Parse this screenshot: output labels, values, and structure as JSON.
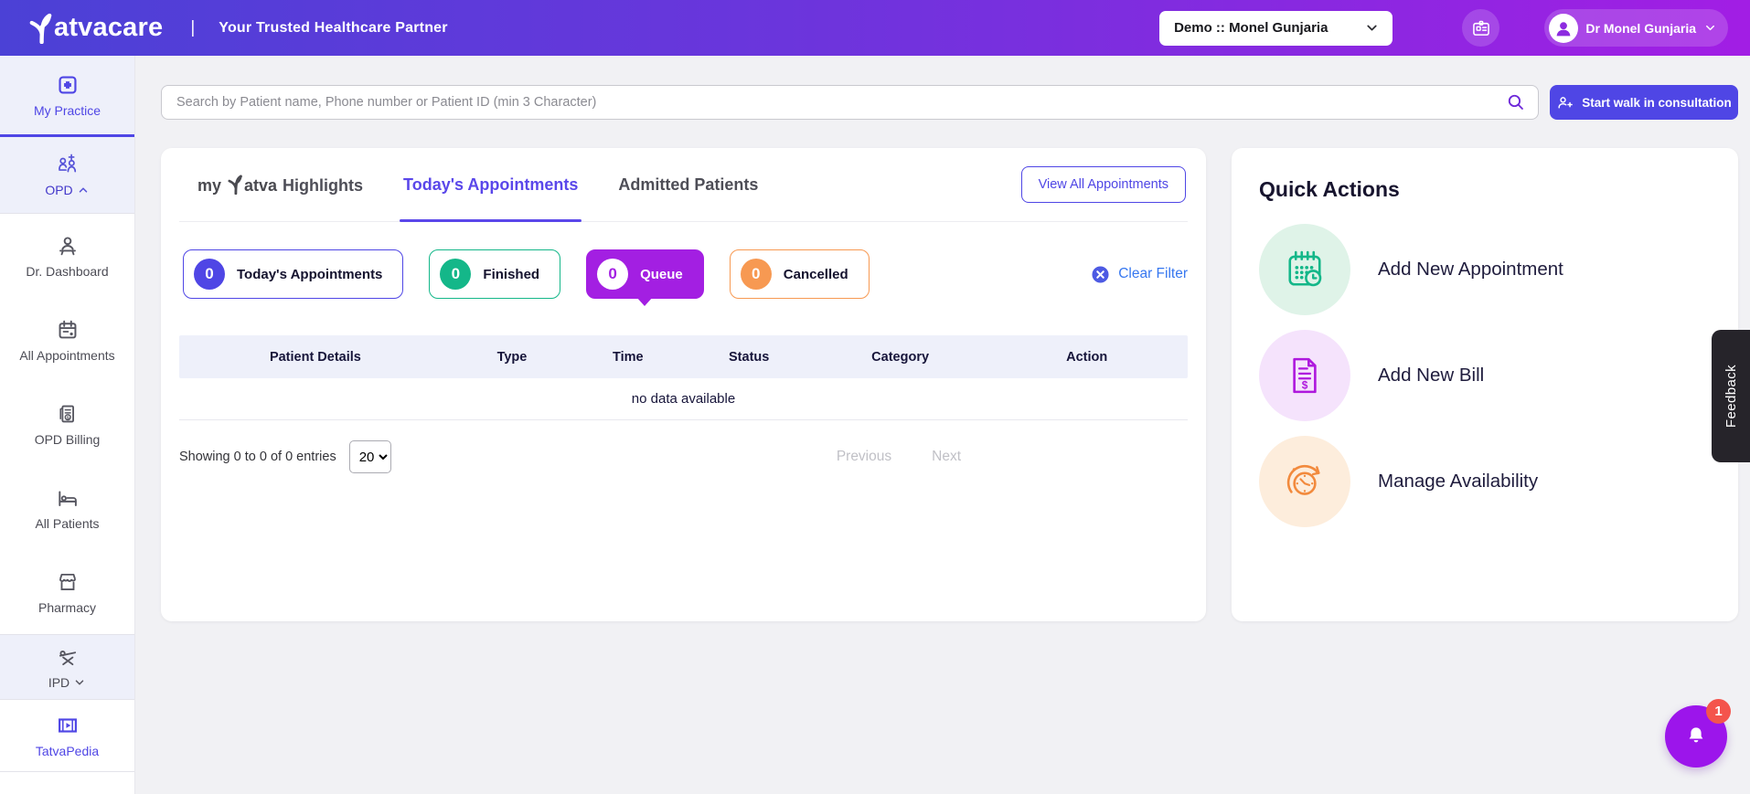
{
  "header": {
    "brand": "atvacare",
    "separator": "|",
    "tagline": "Your Trusted Healthcare Partner",
    "clinic_select_value": "Demo :: Monel Gunjaria",
    "user_name": "Dr Monel Gunjaria"
  },
  "sidebar": {
    "items": [
      {
        "label": "My Practice"
      },
      {
        "label": "OPD"
      },
      {
        "label": "Dr. Dashboard"
      },
      {
        "label": "All Appointments"
      },
      {
        "label": "OPD Billing"
      },
      {
        "label": "All Patients"
      },
      {
        "label": "Pharmacy"
      },
      {
        "label": "IPD"
      },
      {
        "label": "TatvaPedia"
      }
    ]
  },
  "search": {
    "placeholder": "Search by Patient name, Phone number or Patient ID (min 3 Character)"
  },
  "walkin_button": "Start walk in consultation",
  "tabs": {
    "highlights_part1": "my",
    "highlights_part2": "atva",
    "highlights_part3": "Highlights",
    "today": "Today's Appointments",
    "admitted": "Admitted Patients",
    "view_all": "View All Appointments"
  },
  "filters": {
    "chips": [
      {
        "count": "0",
        "label": "Today's Appointments",
        "color": "#4f46e5",
        "selected": false
      },
      {
        "count": "0",
        "label": "Finished",
        "color": "#14b789",
        "selected": false
      },
      {
        "count": "0",
        "label": "Queue",
        "color": "#a31fe2",
        "selected": true
      },
      {
        "count": "0",
        "label": "Cancelled",
        "color": "#f79952",
        "selected": false
      }
    ],
    "clear_label": "Clear Filter"
  },
  "table": {
    "columns": [
      "Patient Details",
      "Type",
      "Time",
      "Status",
      "Category",
      "Action"
    ],
    "empty_text": "no data available",
    "summary": "Showing 0 to 0 of 0 entries",
    "page_size": "20",
    "previous": "Previous",
    "next": "Next"
  },
  "quick_actions": {
    "title": "Quick Actions",
    "items": [
      {
        "label": "Add New Appointment",
        "color": "#14b789"
      },
      {
        "label": "Add New Bill",
        "color": "#ae18dd"
      },
      {
        "label": "Manage Availability",
        "color": "#f28a3d"
      }
    ]
  },
  "feedback_label": "Feedback",
  "notifications": {
    "badge": "1"
  },
  "colors": {
    "accent": "#4f46e5",
    "header_gradient_start": "#4b41d6",
    "header_gradient_end": "#a21ee4",
    "queue_selected": "#a31fe2",
    "fab": "#9c15eb",
    "badge": "#f4544c"
  }
}
